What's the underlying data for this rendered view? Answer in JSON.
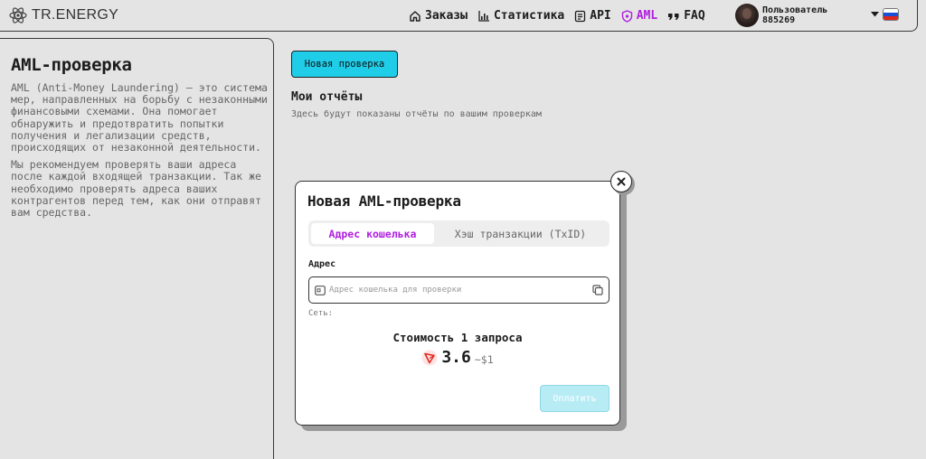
{
  "header": {
    "logo_text": "TR.ENERGY",
    "nav": [
      {
        "label": "Заказы",
        "icon": "home-icon"
      },
      {
        "label": "Статистика",
        "icon": "bar-chart-icon"
      },
      {
        "label": "API",
        "icon": "api-doc-icon"
      },
      {
        "label": "AML",
        "icon": "shield-icon",
        "active": true
      },
      {
        "label": "FAQ",
        "icon": "quote-icon"
      }
    ],
    "user": {
      "label": "Пользователь",
      "id": "885269"
    },
    "accent_color": "#b01ee0"
  },
  "sidebar": {
    "title": "AML-проверка",
    "paragraph1": "AML (Anti-Money Laundering) — это система мер, направленных на борьбу с незаконными финансовыми схемами. Она помогает обнаружить и предотвратить попытки получения и легализации средств, происходящих от незаконной деятельности.",
    "paragraph2": "Мы рекомендуем проверять ваши адреса после каждой входящей транзакции. Так же необходимо проверять адреса ваших контрагентов перед тем, как они отправят вам средства."
  },
  "main": {
    "new_check_button": "Новая проверка",
    "reports_title": "Мои отчёты",
    "reports_subtitle": "Здесь будут показаны отчёты по вашим проверкам",
    "button_color": "#1fcde8"
  },
  "modal": {
    "title": "Новая AML-проверка",
    "tabs": [
      {
        "label": "Адрес кошелька",
        "active": true
      },
      {
        "label": "Хэш транзакции (TxID)",
        "active": false
      }
    ],
    "field_label": "Адрес",
    "address_value": "",
    "address_placeholder": "Адрес кошелька для проверки",
    "network_label": "Сеть:",
    "cost_label": "Стоимость 1 запроса",
    "price": "3.6",
    "price_usd": "~$1",
    "pay_button": "Оплатить"
  }
}
